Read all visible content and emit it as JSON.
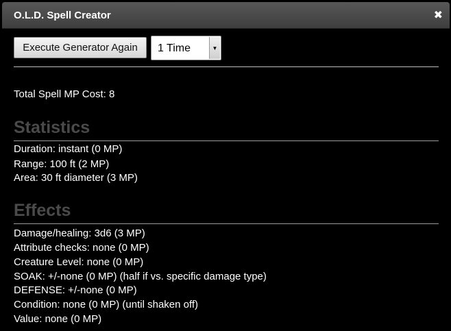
{
  "window": {
    "title": "O.L.D. Spell Creator",
    "close_symbol": "✖",
    "close_icon": "close-icon"
  },
  "toolbar": {
    "execute_label": "Execute Generator Again",
    "times_select": {
      "value": "1 Time",
      "arrow_icon": "chevron-down-icon"
    }
  },
  "summary": {
    "total_cost": "Total Spell MP Cost: 8"
  },
  "statistics": {
    "heading": "Statistics",
    "lines": [
      "Duration: instant (0 MP)",
      "Range: 100 ft (2 MP)",
      "Area: 30 ft diameter (3 MP)"
    ]
  },
  "effects": {
    "heading": "Effects",
    "lines": [
      "Damage/healing: 3d6 (3 MP)",
      "Attribute checks: none (0 MP)",
      "Creature Level: none (0 MP)",
      "SOAK: +/-none (0 MP) (half if vs. specific damage type)",
      "DEFENSE: +/-none (0 MP)",
      "Condition: none (0 MP) (until shaken off)",
      "Value: none (0 MP)"
    ]
  },
  "colors": {
    "background": "#000000",
    "titlebar": "#4a4a4a",
    "heading": "#4a4a4a",
    "text": "#ffffff"
  }
}
